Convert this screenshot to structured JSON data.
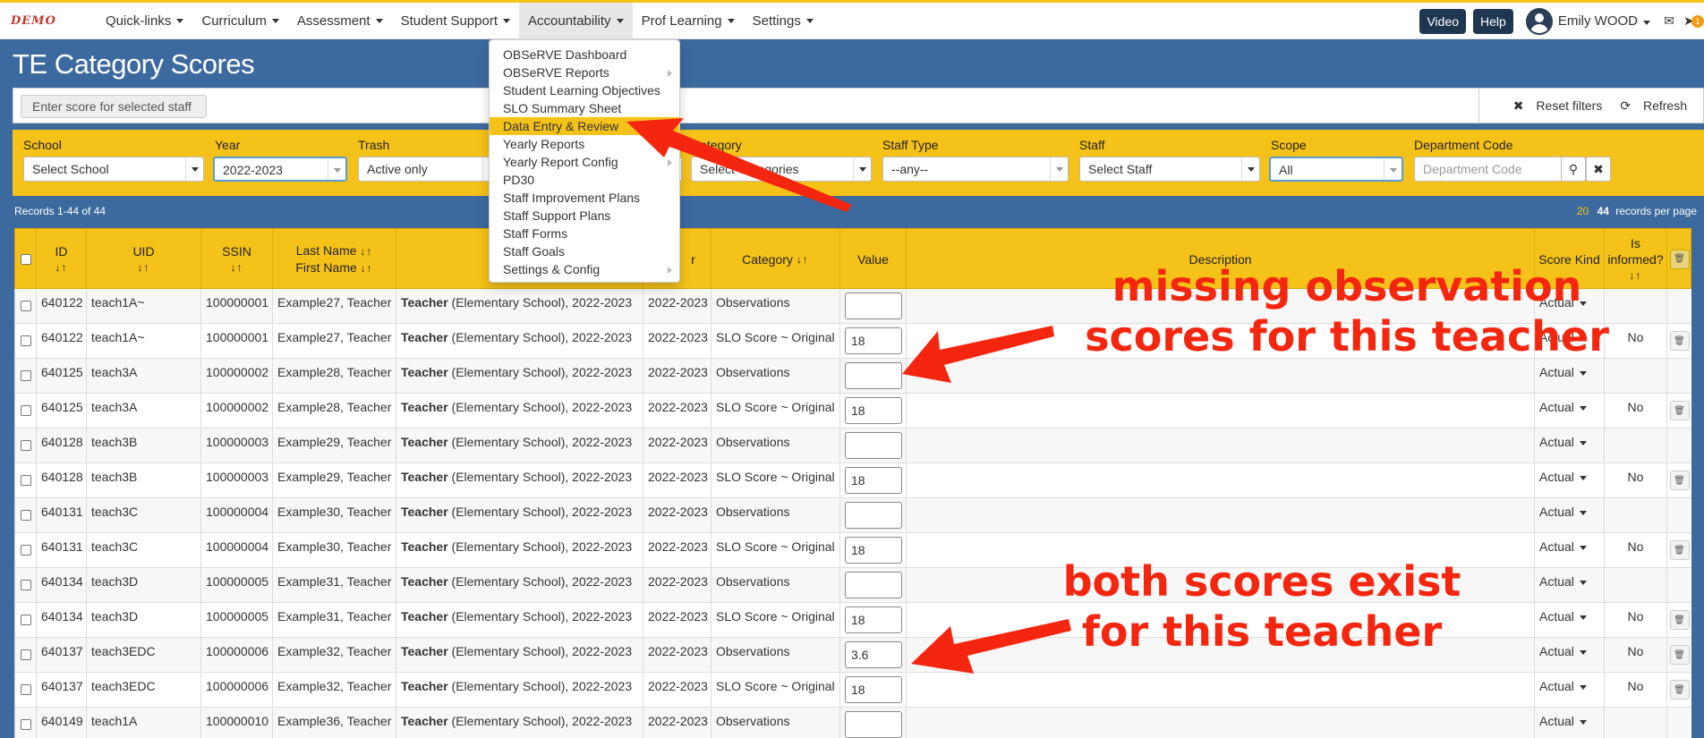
{
  "brand": {
    "logo_text": "DEMO"
  },
  "nav": {
    "items": [
      {
        "label": "Quick-links"
      },
      {
        "label": "Curriculum"
      },
      {
        "label": "Assessment"
      },
      {
        "label": "Student Support"
      },
      {
        "label": "Accountability"
      },
      {
        "label": "Prof Learning"
      },
      {
        "label": "Settings"
      }
    ],
    "active": "Accountability"
  },
  "topright": {
    "video": "Video",
    "help": "Help",
    "user": "Emily WOOD",
    "notification_count": "1"
  },
  "page": {
    "title": "TE Category Scores"
  },
  "scorebar": {
    "placeholder": "Enter score for selected staff",
    "reset": "Reset filters",
    "refresh": "Refresh"
  },
  "filters": {
    "school": {
      "label": "School",
      "value": "Select School"
    },
    "year": {
      "label": "Year",
      "value": "2022-2023"
    },
    "trash": {
      "label": "Trash",
      "value": "Active only"
    },
    "category": {
      "label": "Category",
      "value": "Select Categories"
    },
    "staff_type": {
      "label": "Staff Type",
      "value": "--any--"
    },
    "staff": {
      "label": "Staff",
      "value": "Select Staff"
    },
    "scope": {
      "label": "Scope",
      "value": "All"
    },
    "department_code": {
      "label": "Department Code",
      "placeholder": "Department Code"
    }
  },
  "records": {
    "text": "Records 1-44 of 44"
  },
  "perpage": {
    "opt1": "20",
    "opt2": "44",
    "suffix": "records per page"
  },
  "table": {
    "headers": {
      "id": "ID",
      "uid": "UID",
      "ssin": "SSIN",
      "last_name": "Last Name",
      "first_name": "First Name",
      "year": "r",
      "category": "Category",
      "value": "Value",
      "description": "Description",
      "score_kind": "Score Kind",
      "is_informed_1": "Is",
      "is_informed_2": "informed?"
    },
    "rows": [
      {
        "id": "640122",
        "uid": "teach1A~",
        "ssin": "100000001",
        "name": "Example27, Teacher",
        "role": "Teacher",
        "context": " (Elementary School), 2022-2023",
        "year": "2022-2023",
        "category": "Observations",
        "value": "",
        "kind": "Actual",
        "informed": "",
        "trash": false
      },
      {
        "id": "640122",
        "uid": "teach1A~",
        "ssin": "100000001",
        "name": "Example27, Teacher",
        "role": "Teacher",
        "context": " (Elementary School), 2022-2023",
        "year": "2022-2023",
        "category": "SLO Score ~ Original",
        "value": "18",
        "kind": "Actual",
        "informed": "No",
        "trash": true
      },
      {
        "id": "640125",
        "uid": "teach3A",
        "ssin": "100000002",
        "name": "Example28, Teacher",
        "role": "Teacher",
        "context": " (Elementary School), 2022-2023",
        "year": "2022-2023",
        "category": "Observations",
        "value": "",
        "kind": "Actual",
        "informed": "",
        "trash": false
      },
      {
        "id": "640125",
        "uid": "teach3A",
        "ssin": "100000002",
        "name": "Example28, Teacher",
        "role": "Teacher",
        "context": " (Elementary School), 2022-2023",
        "year": "2022-2023",
        "category": "SLO Score ~ Original",
        "value": "18",
        "kind": "Actual",
        "informed": "No",
        "trash": true
      },
      {
        "id": "640128",
        "uid": "teach3B",
        "ssin": "100000003",
        "name": "Example29, Teacher",
        "role": "Teacher",
        "context": " (Elementary School), 2022-2023",
        "year": "2022-2023",
        "category": "Observations",
        "value": "",
        "kind": "Actual",
        "informed": "",
        "trash": false
      },
      {
        "id": "640128",
        "uid": "teach3B",
        "ssin": "100000003",
        "name": "Example29, Teacher",
        "role": "Teacher",
        "context": " (Elementary School), 2022-2023",
        "year": "2022-2023",
        "category": "SLO Score ~ Original",
        "value": "18",
        "kind": "Actual",
        "informed": "No",
        "trash": true
      },
      {
        "id": "640131",
        "uid": "teach3C",
        "ssin": "100000004",
        "name": "Example30, Teacher",
        "role": "Teacher",
        "context": " (Elementary School), 2022-2023",
        "year": "2022-2023",
        "category": "Observations",
        "value": "",
        "kind": "Actual",
        "informed": "",
        "trash": false
      },
      {
        "id": "640131",
        "uid": "teach3C",
        "ssin": "100000004",
        "name": "Example30, Teacher",
        "role": "Teacher",
        "context": " (Elementary School), 2022-2023",
        "year": "2022-2023",
        "category": "SLO Score ~ Original",
        "value": "18",
        "kind": "Actual",
        "informed": "No",
        "trash": true
      },
      {
        "id": "640134",
        "uid": "teach3D",
        "ssin": "100000005",
        "name": "Example31, Teacher",
        "role": "Teacher",
        "context": " (Elementary School), 2022-2023",
        "year": "2022-2023",
        "category": "Observations",
        "value": "",
        "kind": "Actual",
        "informed": "",
        "trash": false
      },
      {
        "id": "640134",
        "uid": "teach3D",
        "ssin": "100000005",
        "name": "Example31, Teacher",
        "role": "Teacher",
        "context": " (Elementary School), 2022-2023",
        "year": "2022-2023",
        "category": "SLO Score ~ Original",
        "value": "18",
        "kind": "Actual",
        "informed": "No",
        "trash": true
      },
      {
        "id": "640137",
        "uid": "teach3EDC",
        "ssin": "100000006",
        "name": "Example32, Teacher",
        "role": "Teacher",
        "context": " (Elementary School), 2022-2023",
        "year": "2022-2023",
        "category": "Observations",
        "value": "3.6",
        "kind": "Actual",
        "informed": "No",
        "trash": true
      },
      {
        "id": "640137",
        "uid": "teach3EDC",
        "ssin": "100000006",
        "name": "Example32, Teacher",
        "role": "Teacher",
        "context": " (Elementary School), 2022-2023",
        "year": "2022-2023",
        "category": "SLO Score ~ Original",
        "value": "18",
        "kind": "Actual",
        "informed": "No",
        "trash": true
      },
      {
        "id": "640149",
        "uid": "teach1A",
        "ssin": "100000010",
        "name": "Example36, Teacher",
        "role": "Teacher",
        "context": " (Elementary School), 2022-2023",
        "year": "2022-2023",
        "category": "Observations",
        "value": "",
        "kind": "Actual",
        "informed": "",
        "trash": false
      }
    ]
  },
  "accountability_menu": [
    {
      "label": "OBSeRVE Dashboard",
      "submenu": false
    },
    {
      "label": "OBSeRVE Reports",
      "submenu": true
    },
    {
      "label": "Student Learning Objectives",
      "submenu": false
    },
    {
      "label": "SLO Summary Sheet",
      "submenu": false
    },
    {
      "label": "Data Entry & Review",
      "submenu": false,
      "highlighted": true
    },
    {
      "label": "Yearly Reports",
      "submenu": false
    },
    {
      "label": "Yearly Report Config",
      "submenu": true
    },
    {
      "label": "PD30",
      "submenu": false
    },
    {
      "label": "Staff Improvement Plans",
      "submenu": false
    },
    {
      "label": "Staff Support Plans",
      "submenu": false
    },
    {
      "label": "Staff Forms",
      "submenu": false
    },
    {
      "label": "Staff Goals",
      "submenu": false
    },
    {
      "label": "Settings & Config",
      "submenu": true
    }
  ],
  "annotations": {
    "missing_1": "missing observation",
    "missing_2": "scores for this teacher",
    "both_1": "both scores exist",
    "both_2": "for this teacher"
  },
  "colors": {
    "accent": "#f5c21a",
    "page_bg": "#3d6a9e",
    "annotation": "#f4260f",
    "button_dark": "#1f3650"
  }
}
